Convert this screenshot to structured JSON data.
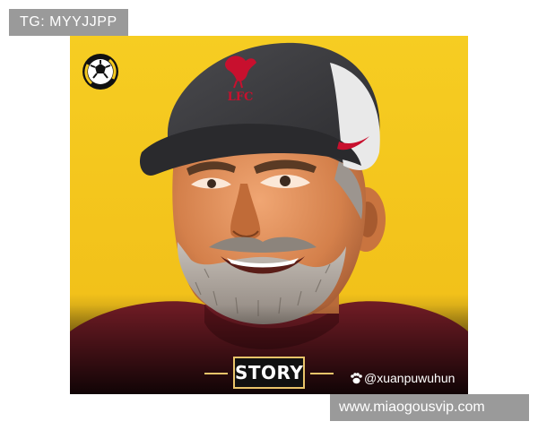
{
  "overlay": {
    "tg_label": "TG: MYYJJPP",
    "site_label": "www.miaogousvip.com"
  },
  "artwork": {
    "cap_text": "LFC",
    "story_label": "STORY",
    "handle": "@xuanpuwuhun",
    "colors": {
      "background": "#f4c91f",
      "cap": "#3d3d40",
      "cap_panel": "#e9e9e9",
      "logo_red": "#c8102e",
      "shirt": "#6e1b24",
      "beard": "#b0a9a3",
      "skin": "#d98a56"
    }
  }
}
